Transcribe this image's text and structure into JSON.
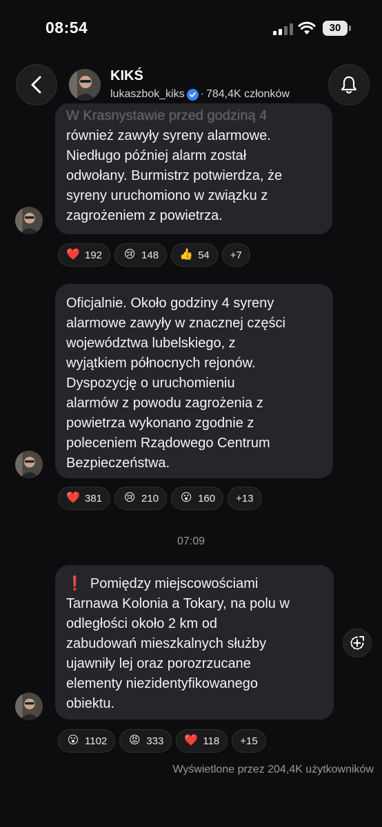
{
  "status_bar": {
    "time": "08:54",
    "battery": "30"
  },
  "header": {
    "channel_name": "KIKŚ",
    "handle": "lukaszbok_kiks",
    "separator": "·",
    "members": "784,4K członków"
  },
  "messages": [
    {
      "lines": [
        "W Krasnystawie przed godziną 4",
        "również zawyły syreny alarmowe.",
        "Niedługo później alarm został",
        "odwołany. Burmistrz potwierdza, że",
        "syreny uruchomiono w związku z",
        "zagrożeniem z powietrza."
      ],
      "reactions": [
        {
          "emoji": "❤️",
          "icon": "heart-icon",
          "count": "192"
        },
        {
          "emoji": "😢",
          "icon": "crying-face-icon",
          "count": "148"
        },
        {
          "emoji": "👍",
          "icon": "thumbs-up-icon",
          "count": "54"
        },
        {
          "emoji": "",
          "icon": "",
          "count": "+7"
        }
      ]
    },
    {
      "lines": [
        "Oficjalnie. Około godziny 4 syreny",
        "alarmowe zawyły w znacznej części",
        "województwa lubelskiego, z",
        "wyjątkiem północnych rejonów.",
        "Dyspozycję o uruchomieniu",
        "alarmów z powodu zagrożenia z",
        "powietrza wykonano zgodnie z",
        "poleceniem Rządowego Centrum",
        "Bezpieczeństwa."
      ],
      "reactions": [
        {
          "emoji": "❤️",
          "icon": "heart-icon",
          "count": "381"
        },
        {
          "emoji": "😢",
          "icon": "crying-face-icon",
          "count": "210"
        },
        {
          "emoji": "😮",
          "icon": "surprised-face-icon",
          "count": "160"
        },
        {
          "emoji": "",
          "icon": "",
          "count": "+13"
        }
      ]
    },
    {
      "prefix": "❗",
      "lines": [
        "Pomiędzy miejscowościami",
        "Tarnawa Kolonia a Tokary, na polu w",
        "odległości około 2 km od",
        "zabudowań mieszkalnych służby",
        "ujawniły lej oraz porozrzucane",
        "elementy niezidentyfikowanego",
        "obiektu."
      ],
      "reactions": [
        {
          "emoji": "😮",
          "icon": "surprised-face-icon",
          "count": "1102"
        },
        {
          "emoji": "😡",
          "icon": "angry-face-icon",
          "count": "333"
        },
        {
          "emoji": "❤️",
          "icon": "heart-icon",
          "count": "118"
        },
        {
          "emoji": "",
          "icon": "",
          "count": "+15"
        }
      ]
    }
  ],
  "time_divider": "07:09",
  "views_text": "Wyświetlone przez 204,4K użytkowników",
  "colors": {
    "background": "#0d0d0f",
    "bubble": "#26262a",
    "verified": "#3b82f6",
    "alert": "#e1262c"
  }
}
